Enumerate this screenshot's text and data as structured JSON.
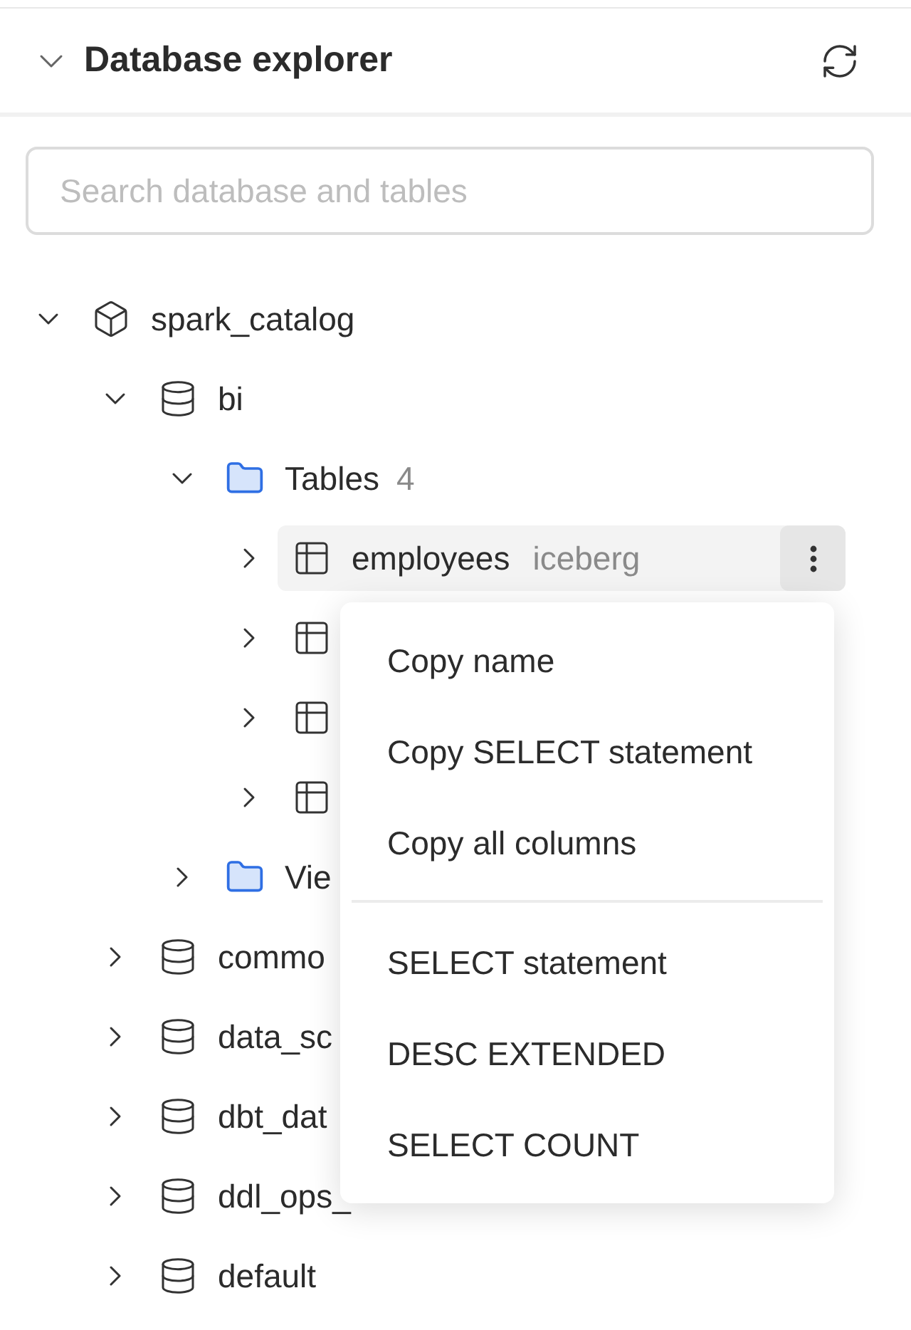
{
  "header": {
    "title": "Database explorer",
    "expanded": true
  },
  "search": {
    "placeholder": "Search database and tables"
  },
  "tree": [
    {
      "kind": "catalog",
      "name": "spark_catalog",
      "expanded": true,
      "children": [
        {
          "kind": "database",
          "name": "bi",
          "expanded": true,
          "children": [
            {
              "kind": "folder",
              "name": "Tables",
              "count": "4",
              "expanded": true,
              "children": [
                {
                  "kind": "table",
                  "name": "employees",
                  "format": "iceberg",
                  "expanded": false,
                  "selected": true
                },
                {
                  "kind": "table",
                  "expanded": false,
                  "selected": false
                },
                {
                  "kind": "table",
                  "expanded": false,
                  "selected": false
                },
                {
                  "kind": "table",
                  "expanded": false,
                  "selected": false
                }
              ]
            },
            {
              "kind": "folder",
              "name": "Vie",
              "expanded": false
            }
          ]
        },
        {
          "kind": "database",
          "name": "commo",
          "expanded": false
        },
        {
          "kind": "database",
          "name": "data_sc",
          "expanded": false
        },
        {
          "kind": "database",
          "name": "dbt_dat",
          "expanded": false
        },
        {
          "kind": "database",
          "name": "ddl_ops_",
          "expanded": false
        },
        {
          "kind": "database",
          "name": "default",
          "expanded": false
        }
      ]
    }
  ],
  "context_menu": {
    "groups": [
      [
        "Copy name",
        "Copy SELECT statement",
        "Copy all columns"
      ],
      [
        "SELECT statement",
        "DESC EXTENDED",
        "SELECT COUNT"
      ]
    ]
  }
}
